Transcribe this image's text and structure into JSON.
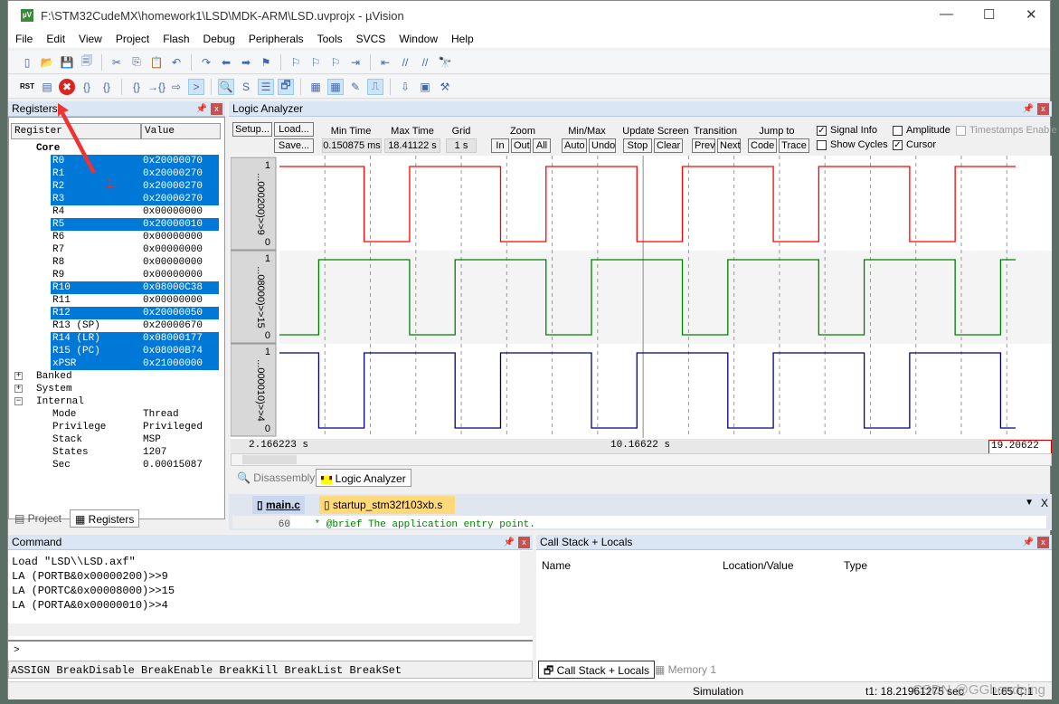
{
  "window": {
    "title": "F:\\STM32CudeMX\\homework1\\LSD\\MDK-ARM\\LSD.uvprojx - µVision",
    "controls": [
      "—",
      "☐",
      "✕"
    ]
  },
  "menu": [
    "File",
    "Edit",
    "View",
    "Project",
    "Flash",
    "Debug",
    "Peripherals",
    "Tools",
    "SVCS",
    "Window",
    "Help"
  ],
  "toolbar1": [
    "new-file",
    "open",
    "save",
    "save-all",
    "cut",
    "copy",
    "paste",
    "undo",
    "redo",
    "back",
    "forward",
    "bookmark",
    "prev-bookmark",
    "next-bookmark",
    "clear-bookmarks",
    "indent",
    "unindent",
    "comment",
    "uncomment",
    "find-in-files"
  ],
  "toolbar2": {
    "rst_label": "RST",
    "icons": [
      "reset",
      "run",
      "stop",
      "step",
      "step-over",
      "step-out",
      "run-to-cursor",
      "show-next",
      "command-window",
      "disassembly-window",
      "symbols-window",
      "registers-window",
      "call-stack-window",
      "watch-window",
      "memory-window",
      "serial-window",
      "analysis-window",
      "trace-window",
      "system-viewer",
      "toolbox"
    ]
  },
  "registers": {
    "title": "Registers",
    "col_register": "Register",
    "col_value": "Value",
    "core_label": "Core",
    "rows": [
      {
        "name": "R0",
        "value": "0x20000070",
        "selected": true
      },
      {
        "name": "R1",
        "value": "0x20000270",
        "selected": true
      },
      {
        "name": "R2",
        "value": "0x20000270",
        "selected": true
      },
      {
        "name": "R3",
        "value": "0x20000270",
        "selected": true
      },
      {
        "name": "R4",
        "value": "0x00000000",
        "selected": false
      },
      {
        "name": "R5",
        "value": "0x20000010",
        "selected": true
      },
      {
        "name": "R6",
        "value": "0x00000000",
        "selected": false
      },
      {
        "name": "R7",
        "value": "0x00000000",
        "selected": false
      },
      {
        "name": "R8",
        "value": "0x00000000",
        "selected": false
      },
      {
        "name": "R9",
        "value": "0x00000000",
        "selected": false
      },
      {
        "name": "R10",
        "value": "0x08000C38",
        "selected": true
      },
      {
        "name": "R11",
        "value": "0x00000000",
        "selected": false
      },
      {
        "name": "R12",
        "value": "0x20000050",
        "selected": true
      },
      {
        "name": "R13 (SP)",
        "value": "0x20000670",
        "selected": false
      },
      {
        "name": "R14 (LR)",
        "value": "0x08000177",
        "selected": true
      },
      {
        "name": "R15 (PC)",
        "value": "0x08000B74",
        "selected": true
      },
      {
        "name": "xPSR",
        "value": "0x21000000",
        "selected": true
      }
    ],
    "groups": [
      "Banked",
      "System",
      "Internal"
    ],
    "internal": [
      {
        "name": "Mode",
        "value": "Thread"
      },
      {
        "name": "Privilege",
        "value": "Privileged"
      },
      {
        "name": "Stack",
        "value": "MSP"
      },
      {
        "name": "States",
        "value": "1207"
      },
      {
        "name": "Sec",
        "value": "0.00015087"
      }
    ],
    "annotation": "1.",
    "tabs": [
      "Project",
      "Registers"
    ]
  },
  "logic": {
    "title": "Logic Analyzer",
    "setup": "Setup...",
    "load": "Load...",
    "save": "Save...",
    "min_time_label": "Min Time",
    "min_time": "0.150875 ms",
    "max_time_label": "Max Time",
    "max_time": "18.41122 s",
    "grid_label": "Grid",
    "grid": "1 s",
    "zoom_label": "Zoom",
    "zoom_in": "In",
    "zoom_out": "Out",
    "zoom_all": "All",
    "minmax_label": "Min/Max",
    "auto": "Auto",
    "undo": "Undo",
    "update_label": "Update Screen",
    "stop": "Stop",
    "clear": "Clear",
    "transition_label": "Transition",
    "prev": "Prev",
    "next": "Next",
    "jump_label": "Jump to",
    "code": "Code",
    "trace": "Trace",
    "signal_info": "Signal Info",
    "signal_info_checked": true,
    "amplitude": "Amplitude",
    "amplitude_checked": false,
    "timestamps": "Timestamps Enable",
    "timestamps_checked": false,
    "show_cycles": "Show Cycles",
    "show_cycles_checked": false,
    "cursor": "Cursor",
    "cursor_checked": true,
    "time_left": "2.166223 s",
    "time_center": "10.16622 s",
    "time_right": "19.20622 s",
    "tabs": [
      "Disassembly",
      "Logic Analyzer"
    ]
  },
  "chart_data": {
    "type": "line",
    "step": true,
    "xlim": [
      2.166223,
      18.36
    ],
    "grid_interval": 1,
    "grid": true,
    "cursor_x": 10.16622,
    "signals": [
      {
        "name": "...000200)>>9",
        "color": "#ff0000",
        "ymin_label": "0",
        "ymax_label": "1",
        "initial": 1,
        "edges": [
          4.03,
          5.03,
          7.03,
          8.03,
          10.03,
          11.03,
          13.03,
          14.03,
          16.03,
          17.03
        ]
      },
      {
        "name": "...08000)>>15",
        "color": "#008000",
        "ymin_label": "0",
        "ymax_label": "1",
        "initial": 0,
        "edges": [
          3.03,
          5.03,
          6.03,
          8.03,
          9.03,
          11.03,
          12.03,
          14.03,
          15.03,
          17.03,
          18.03
        ]
      },
      {
        "name": "...000010)>>4",
        "color": "#000080",
        "ymin_label": "0",
        "ymax_label": "1",
        "initial": 1,
        "edges": [
          3.03,
          4.03,
          6.03,
          7.03,
          9.03,
          10.03,
          12.03,
          13.03,
          15.03,
          16.03,
          18.03
        ]
      }
    ]
  },
  "editor": {
    "tabs": [
      "main.c",
      "startup_stm32f103xb.s"
    ],
    "line_no": "60",
    "line_text": "* @brief  The application entry point."
  },
  "command": {
    "title": "Command",
    "lines": [
      "Load \"LSD\\\\LSD.axf\"",
      "LA (PORTB&0x00000200)>>9",
      "LA (PORTC&0x00008000)>>15",
      "LA (PORTA&0x00000010)>>4"
    ],
    "prompt": ">",
    "hints": "ASSIGN BreakDisable BreakEnable BreakKill BreakList BreakSet"
  },
  "callstack": {
    "title": "Call Stack + Locals",
    "cols": [
      "Name",
      "Location/Value",
      "Type"
    ],
    "tabs": [
      "Call Stack + Locals",
      "Memory 1"
    ]
  },
  "status": {
    "mode": "Simulation",
    "t1": "t1: 18.21961275 sec",
    "pos": "L:65 C:1",
    "watermark": "CSDN @GGbondping"
  },
  "colors": {
    "selection": "#0078d7",
    "panel_title": "#dbe6f4",
    "accent_red": "#c75050"
  }
}
